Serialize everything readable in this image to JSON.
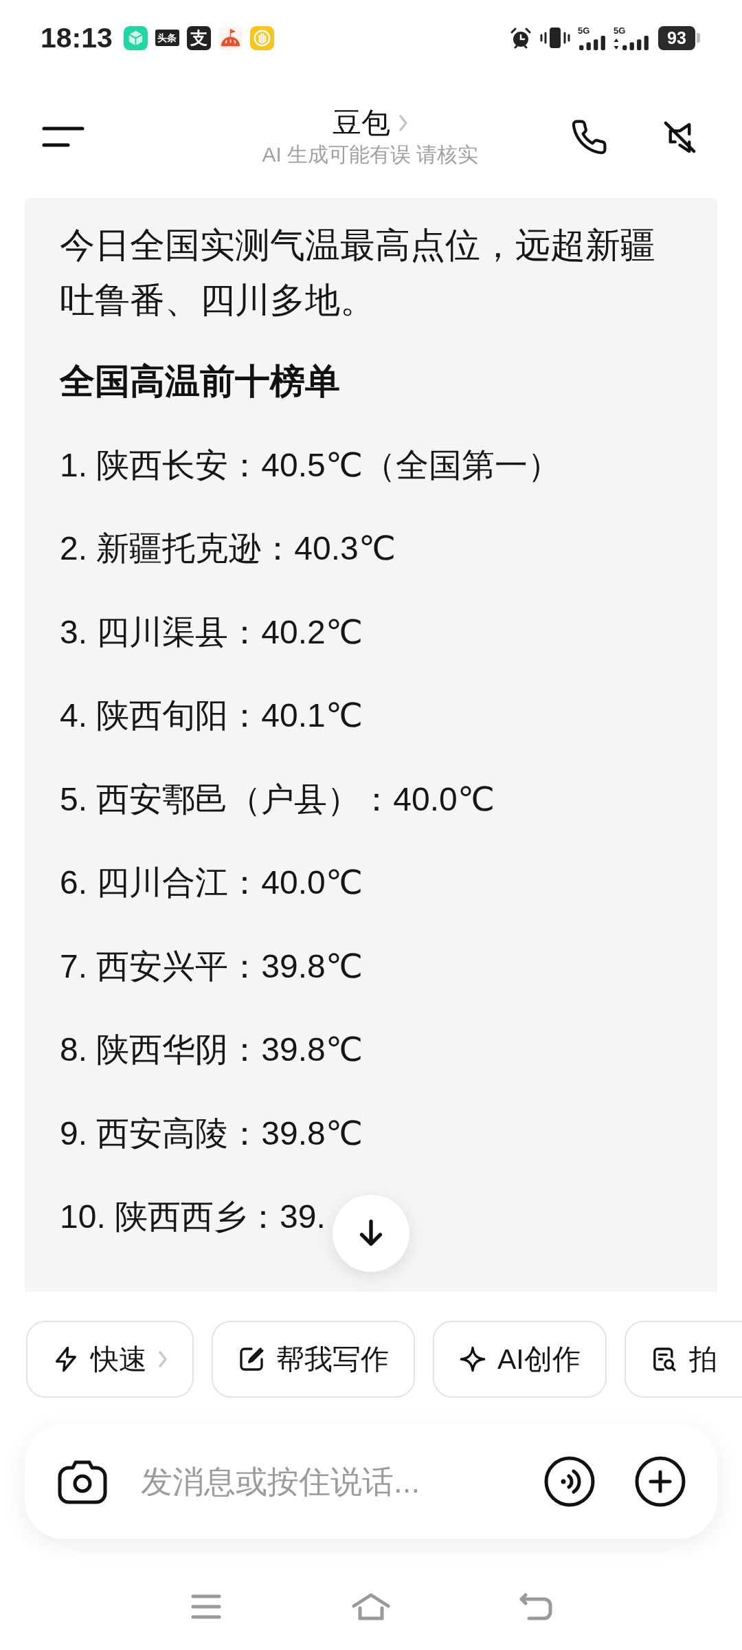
{
  "status_bar": {
    "time": "18:13",
    "notifications": [
      {
        "kind": "cube",
        "color": "#20d6a2"
      },
      {
        "kind": "text",
        "text": "头条"
      },
      {
        "kind": "text",
        "text": "支"
      },
      {
        "kind": "dome",
        "color": "#e8512a"
      },
      {
        "kind": "hand",
        "color": "#f7c51e"
      }
    ],
    "indicators": [
      {
        "kind": "alarm"
      },
      {
        "kind": "vibrate"
      },
      {
        "kind": "signal",
        "label": "5G",
        "activity": false
      },
      {
        "kind": "signal",
        "label": "5G",
        "activity": true
      }
    ],
    "battery": "93"
  },
  "header": {
    "title": "豆包",
    "subtitle": "AI 生成可能有误 请核实"
  },
  "message": {
    "paragraph": "今日全国实测气温最高点位，远超新疆吐鲁番、四川多地。",
    "heading": "全国高温前十榜单",
    "items": [
      "1. 陕西长安：40.5℃（全国第一）",
      "2. 新疆托克逊：40.3℃",
      "3. 四川渠县：40.2℃",
      "4. 陕西旬阳：40.1℃",
      "5. 西安鄠邑（户县）：40.0℃",
      "6. 四川合江：40.0℃",
      "7. 西安兴平：39.8℃",
      "8. 陕西华阴：39.8℃",
      "9. 西安高陵：39.8℃",
      "10. 陕西西乡：39."
    ]
  },
  "chips": [
    {
      "kind": "bolt",
      "label": "快速",
      "chevron": true
    },
    {
      "kind": "edit",
      "label": "帮我写作",
      "chevron": false
    },
    {
      "kind": "sparkle",
      "label": "AI创作",
      "chevron": false
    },
    {
      "kind": "doc-search",
      "label": "拍",
      "chevron": false
    }
  ],
  "composer": {
    "placeholder": "发消息或按住说话..."
  }
}
